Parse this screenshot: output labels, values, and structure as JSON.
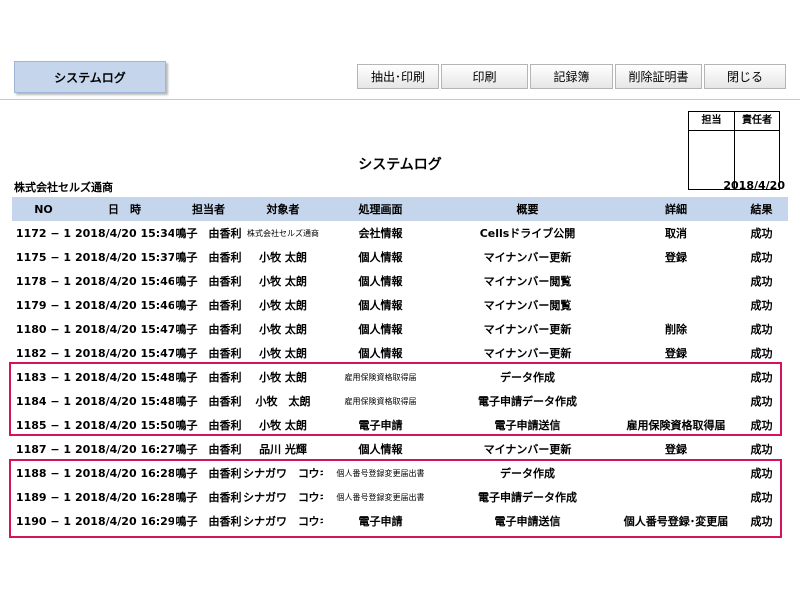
{
  "header": {
    "tab_title": "システムログ",
    "buttons": [
      "抽出･印刷",
      "印刷",
      "記録簿",
      "削除証明書",
      "閉じる"
    ]
  },
  "stamp": {
    "labels": [
      "担当",
      "責任者"
    ]
  },
  "report": {
    "title": "システムログ",
    "company": "株式会社セルズ通商",
    "date": "2018/4/20"
  },
  "table": {
    "columns": [
      "NO",
      "日　時",
      "担当者",
      "対象者",
      "処理画面",
      "概要",
      "詳細",
      "結果"
    ],
    "rows": [
      [
        "1172 − 1",
        "2018/4/20 15:34",
        "鳴子　由香利",
        "株式会社セルズ通商",
        "会社情報",
        "Cellsドライブ公開",
        "取消",
        "成功"
      ],
      [
        "1175 − 1",
        "2018/4/20 15:37",
        "鳴子　由香利",
        "小牧 太朗",
        "個人情報",
        "マイナンバー更新",
        "登録",
        "成功"
      ],
      [
        "1178 − 1",
        "2018/4/20 15:46",
        "鳴子　由香利",
        "小牧 太朗",
        "個人情報",
        "マイナンバー閲覧",
        "",
        "成功"
      ],
      [
        "1179 − 1",
        "2018/4/20 15:46",
        "鳴子　由香利",
        "小牧 太朗",
        "個人情報",
        "マイナンバー閲覧",
        "",
        "成功"
      ],
      [
        "1180 − 1",
        "2018/4/20 15:47",
        "鳴子　由香利",
        "小牧 太朗",
        "個人情報",
        "マイナンバー更新",
        "削除",
        "成功"
      ],
      [
        "1182 − 1",
        "2018/4/20 15:47",
        "鳴子　由香利",
        "小牧 太朗",
        "個人情報",
        "マイナンバー更新",
        "登録",
        "成功"
      ],
      [
        "1183 − 1",
        "2018/4/20 15:48",
        "鳴子　由香利",
        "小牧 太朗",
        "雇用保険資格取得届",
        "データ作成",
        "",
        "成功"
      ],
      [
        "1184 − 1",
        "2018/4/20 15:48",
        "鳴子　由香利",
        "小牧　太朗",
        "雇用保険資格取得届",
        "電子申請データ作成",
        "",
        "成功"
      ],
      [
        "1185 − 1",
        "2018/4/20 15:50",
        "鳴子　由香利",
        "小牧 太朗",
        "電子申請",
        "電子申請送信",
        "雇用保険資格取得届",
        "成功"
      ],
      [
        "1187 − 1",
        "2018/4/20 16:27",
        "鳴子　由香利",
        "品川 光輝",
        "個人情報",
        "マイナンバー更新",
        "登録",
        "成功"
      ],
      [
        "1188 − 1",
        "2018/4/20 16:28",
        "鳴子　由香利",
        "シナガワ　コウキ",
        "個人番号登録変更届出書",
        "データ作成",
        "",
        "成功"
      ],
      [
        "1189 − 1",
        "2018/4/20 16:28",
        "鳴子　由香利",
        "シナガワ　コウキ",
        "個人番号登録変更届出書",
        "電子申請データ作成",
        "",
        "成功"
      ],
      [
        "1190 − 1",
        "2018/4/20 16:29",
        "鳴子　由香利",
        "シナガワ　コウキ",
        "電子申請",
        "電子申請送信",
        "個人番号登録･変更届",
        "成功"
      ]
    ]
  }
}
